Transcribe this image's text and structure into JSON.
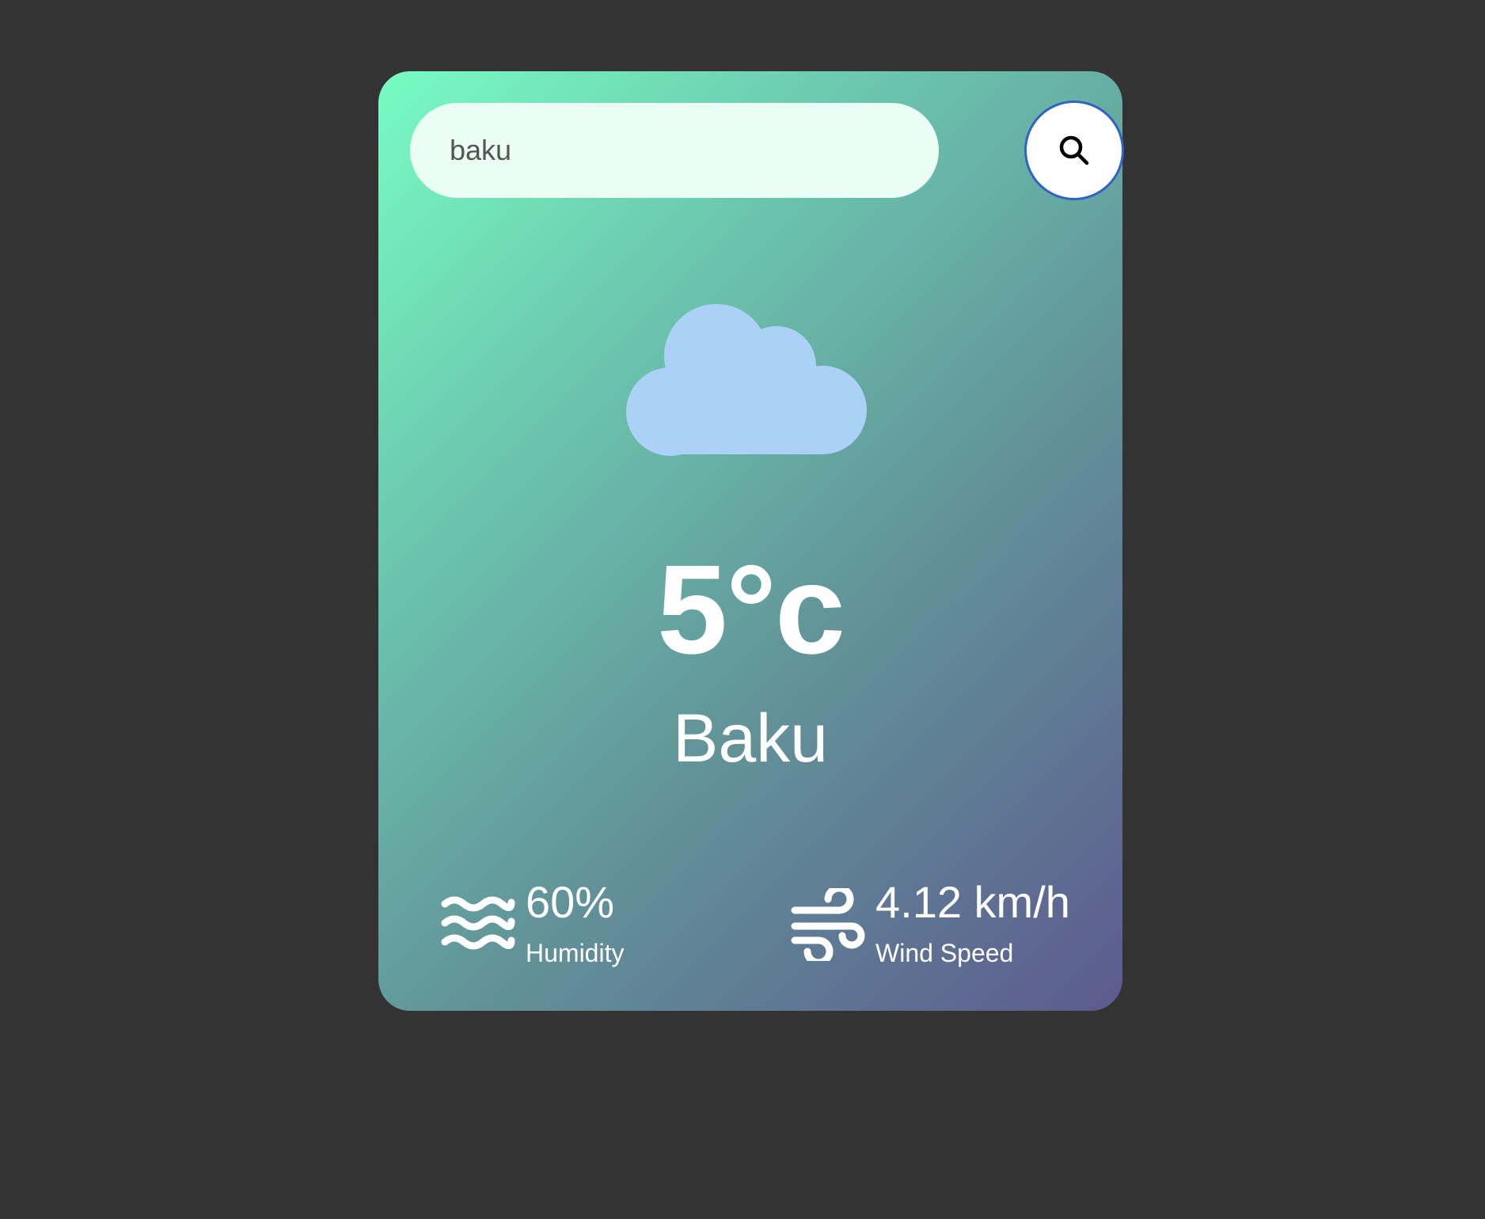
{
  "search": {
    "value": "baku",
    "button_icon": "search-icon"
  },
  "weather": {
    "icon": "cloud-icon",
    "temperature": "5°c",
    "city": "Baku"
  },
  "stats": {
    "humidity": {
      "icon": "humidity-waves-icon",
      "value": "60%",
      "label": "Humidity"
    },
    "wind": {
      "icon": "wind-icon",
      "value": "4.12 km/h",
      "label": "Wind Speed"
    }
  },
  "colors": {
    "page_background": "#333333",
    "card_gradient_start": "#78fcc3",
    "card_gradient_end": "#5c5a8e",
    "input_background": "#ebfef6",
    "cloud": "#acd1f6",
    "button_ring": "#2f63c4",
    "text": "#ffffff"
  }
}
